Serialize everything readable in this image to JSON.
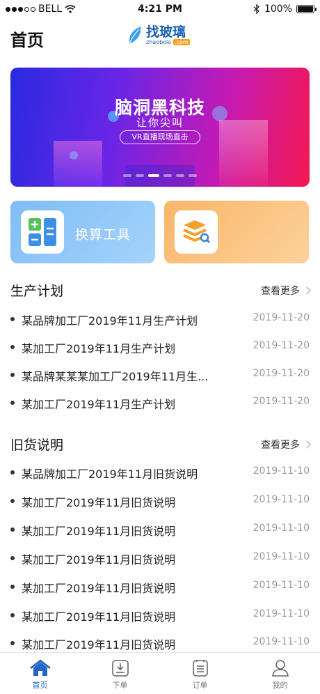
{
  "status_bar": {
    "carrier": "BELL",
    "time": "4:21 PM",
    "battery": "100%"
  },
  "header": {
    "title": "首页",
    "logo_text": "找玻璃",
    "logo_sub": "zhaobolo",
    "logo_com": ".com"
  },
  "banner": {
    "title": "脑洞黑科技",
    "subtitle": "让你尖叫",
    "pill": "VR直播现场直击",
    "pages": 6,
    "active_page": 3
  },
  "tools": [
    {
      "label": "换算工具",
      "icon": "calculator-icon"
    },
    {
      "label": "",
      "icon": "layers-search-icon"
    }
  ],
  "production": {
    "title": "生产计划",
    "more": "查看更多",
    "items": [
      {
        "title": "某品牌加工厂2019年11月生产计划",
        "date": "2019-11-20"
      },
      {
        "title": "某加工厂2019年11月生产计划",
        "date": "2019-11-20"
      },
      {
        "title": "某品牌某某某加工厂2019年11月生...",
        "date": "2019-11-20"
      },
      {
        "title": "某加工厂2019年11月生产计划",
        "date": "2019-11-20"
      }
    ]
  },
  "old_goods": {
    "title": "旧货说明",
    "more": "查看更多",
    "items": [
      {
        "title": "某品牌加工厂2019年11月旧货说明",
        "date": "2019-11-10"
      },
      {
        "title": "某加工厂2019年11月旧货说明",
        "date": "2019-11-10"
      },
      {
        "title": "某加工厂2019年11月旧货说明",
        "date": "2019-11-10"
      },
      {
        "title": "某加工厂2019年11月旧货说明",
        "date": "2019-11-10"
      },
      {
        "title": "某加工厂2019年11月旧货说明",
        "date": "2019-11-10"
      },
      {
        "title": "某加工厂2019年11月旧货说明",
        "date": "2019-11-10"
      },
      {
        "title": "某加工厂2019年11月旧货说明",
        "date": "2019-11-10"
      }
    ]
  },
  "tabbar": [
    {
      "label": "首页",
      "icon": "home-icon",
      "active": true
    },
    {
      "label": "下单",
      "icon": "download-tray-icon",
      "active": false
    },
    {
      "label": "订单",
      "icon": "order-list-icon",
      "active": false
    },
    {
      "label": "我的",
      "icon": "user-icon",
      "active": false
    }
  ],
  "colors": {
    "accent": "#2266cc",
    "tool_blue": "#8cc4f7",
    "tool_orange": "#fbc27e"
  }
}
